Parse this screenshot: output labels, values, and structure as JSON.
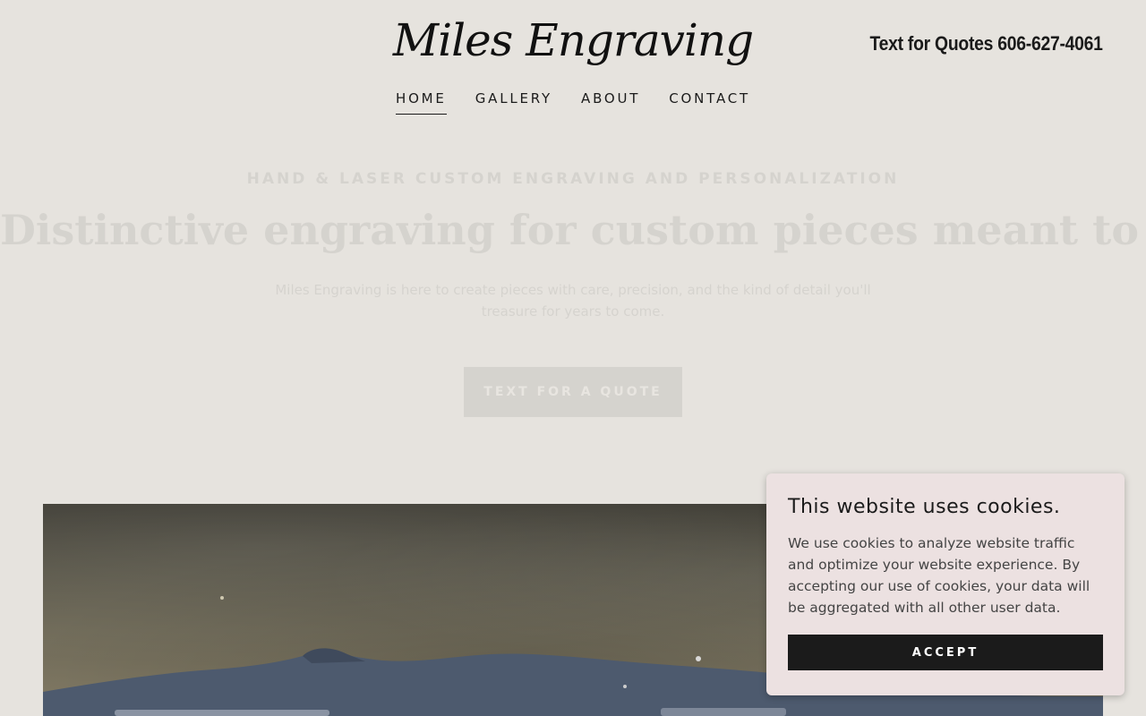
{
  "header": {
    "logo": "Miles Engraving",
    "phone": "Text for Quotes 606-627-4061"
  },
  "nav": {
    "items": [
      {
        "label": "HOME",
        "active": true
      },
      {
        "label": "GALLERY",
        "active": false
      },
      {
        "label": "ABOUT",
        "active": false
      },
      {
        "label": "CONTACT",
        "active": false
      }
    ]
  },
  "hero": {
    "kicker": "HAND & LASER CUSTOM ENGRAVING AND PERSONALIZATION",
    "title": "Distinctive engraving for custom pieces meant to be kept.",
    "subtitle": "Miles Engraving is here to create pieces with care, precision, and the kind of detail you'll treasure for years to come.",
    "button_label": "TEXT FOR A QUOTE"
  },
  "cookie_banner": {
    "title": "This website uses cookies.",
    "text": "We use cookies to analyze website traffic and optimize your website experience. By accepting our use of cookies, your data will be aggregated with all other user data.",
    "accept_label": "ACCEPT"
  },
  "colors": {
    "background": "#e6e3de",
    "text": "#1b1b1b",
    "cookie_bg": "#ece1e1",
    "button_bg": "#1b1b1b"
  }
}
